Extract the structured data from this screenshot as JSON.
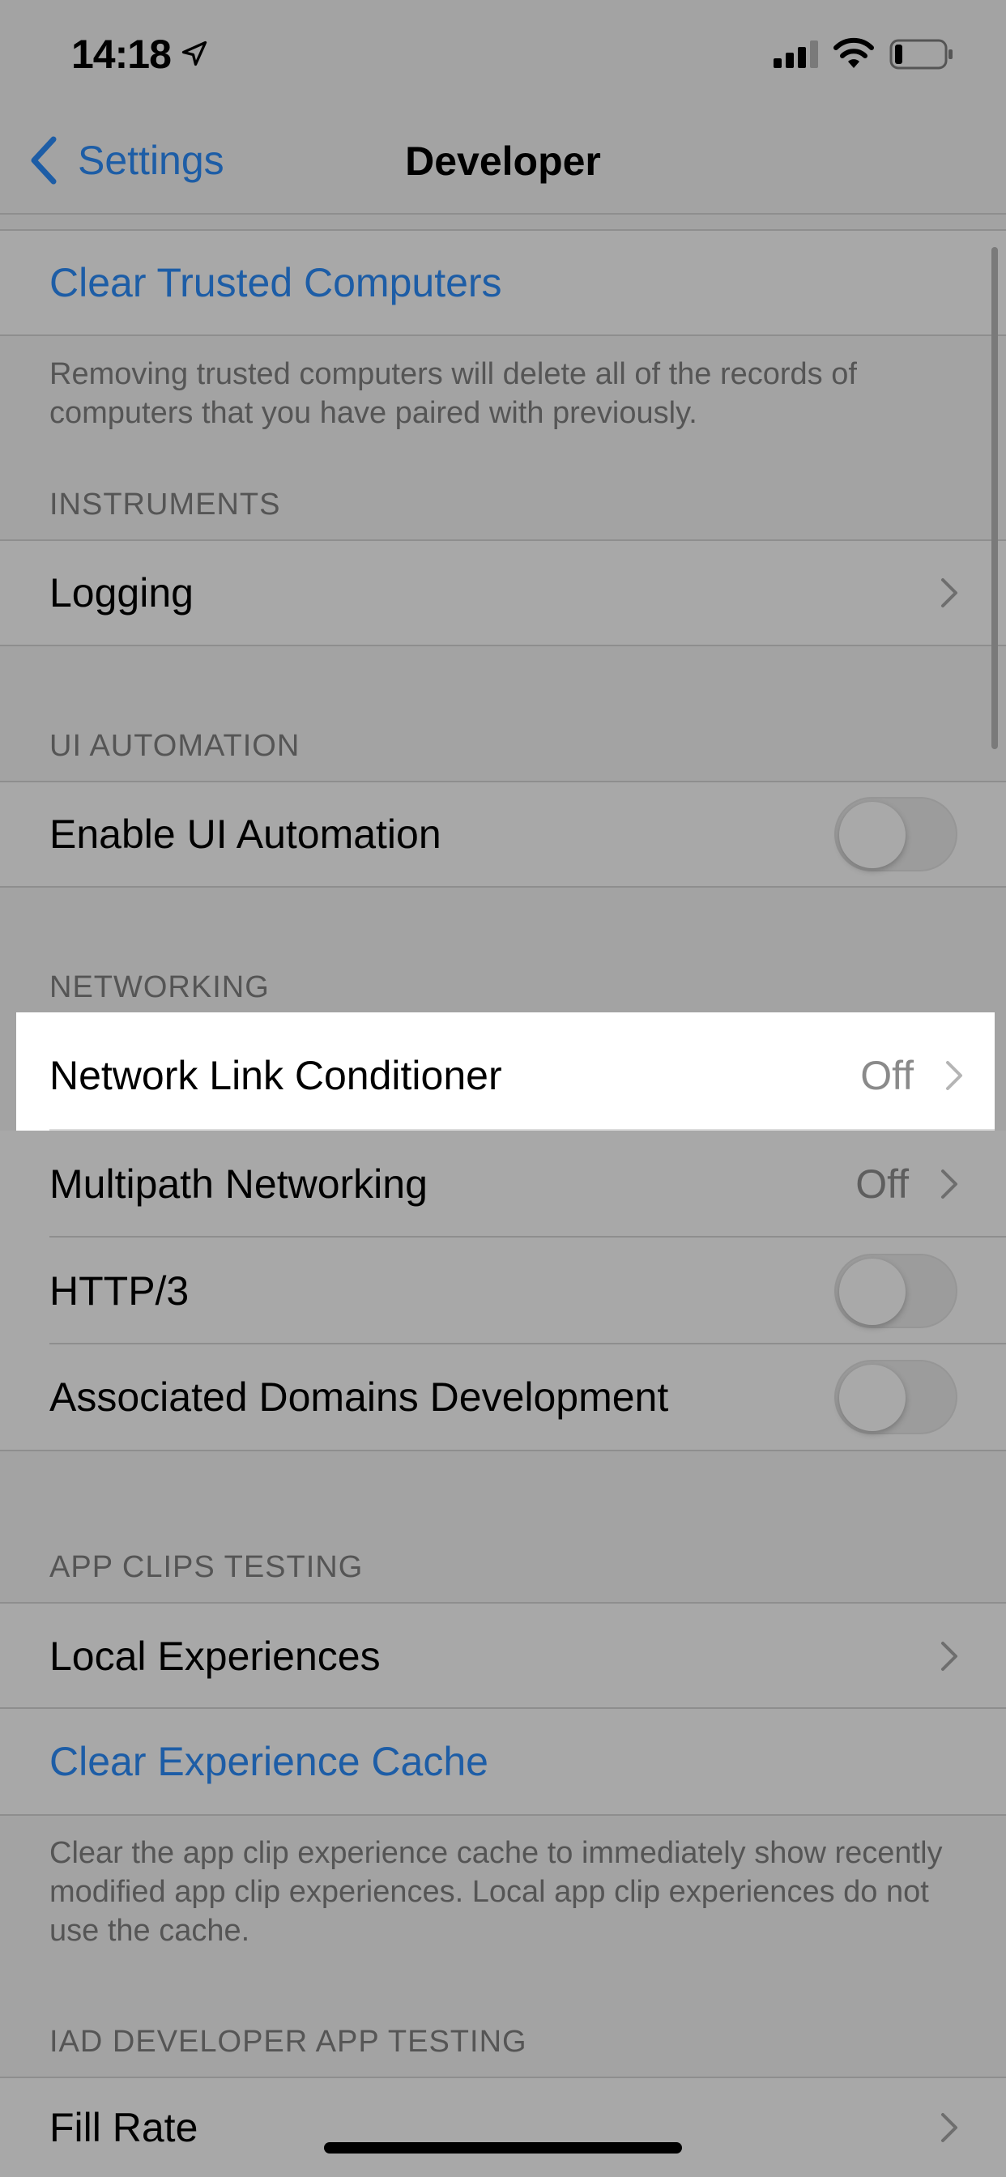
{
  "status_bar": {
    "time": "14:18",
    "icons": [
      "location-arrow-icon",
      "cellular-signal-icon",
      "wifi-icon",
      "battery-icon"
    ]
  },
  "nav": {
    "back_label": "Settings",
    "title": "Developer"
  },
  "colors": {
    "link": "#1d5da6",
    "background_dimmed": "#a3a3a3",
    "highlight": "#ffffff"
  },
  "rows": {
    "clear_trusted": {
      "label": "Clear Trusted Computers"
    },
    "clear_trusted_footer": "Removing trusted computers will delete all of the records of computers that you have paired with previously.",
    "instruments_header": "INSTRUMENTS",
    "logging": {
      "label": "Logging"
    },
    "ui_automation_header": "UI AUTOMATION",
    "enable_ui_automation": {
      "label": "Enable UI Automation",
      "on": false
    },
    "networking_header": "NETWORKING",
    "network_link_conditioner": {
      "label": "Network Link Conditioner",
      "value": "Off"
    },
    "multipath_networking": {
      "label": "Multipath Networking",
      "value": "Off"
    },
    "http3": {
      "label": "HTTP/3",
      "on": false
    },
    "associated_domains": {
      "label": "Associated Domains Development",
      "on": false
    },
    "app_clips_header": "APP CLIPS TESTING",
    "local_experiences": {
      "label": "Local Experiences"
    },
    "clear_experience_cache": {
      "label": "Clear Experience Cache"
    },
    "app_clips_footer": "Clear the app clip experience cache to immediately show recently modified app clip experiences. Local app clip experiences do not use the cache.",
    "iad_header": "IAD DEVELOPER APP TESTING",
    "fill_rate": {
      "label": "Fill Rate"
    }
  }
}
